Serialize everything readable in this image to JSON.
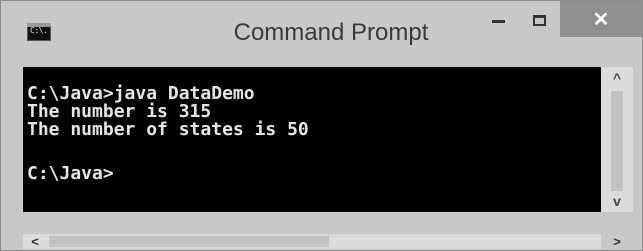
{
  "window": {
    "title": "Command Prompt",
    "icon": "cmd-icon",
    "icon_text": "C:\\."
  },
  "controls": {
    "minimize": "minimize-icon",
    "maximize": "maximize-icon",
    "close": "close-icon",
    "close_glyph": "✕"
  },
  "console": {
    "lines": [
      "C:\\Java>java DataDemo",
      "The number is 315",
      "The number of states is 50",
      "",
      "C:\\Java>"
    ]
  },
  "scrollbars": {
    "up_glyph": "^",
    "down_glyph": "v",
    "left_glyph": "<",
    "right_glyph": ">"
  }
}
